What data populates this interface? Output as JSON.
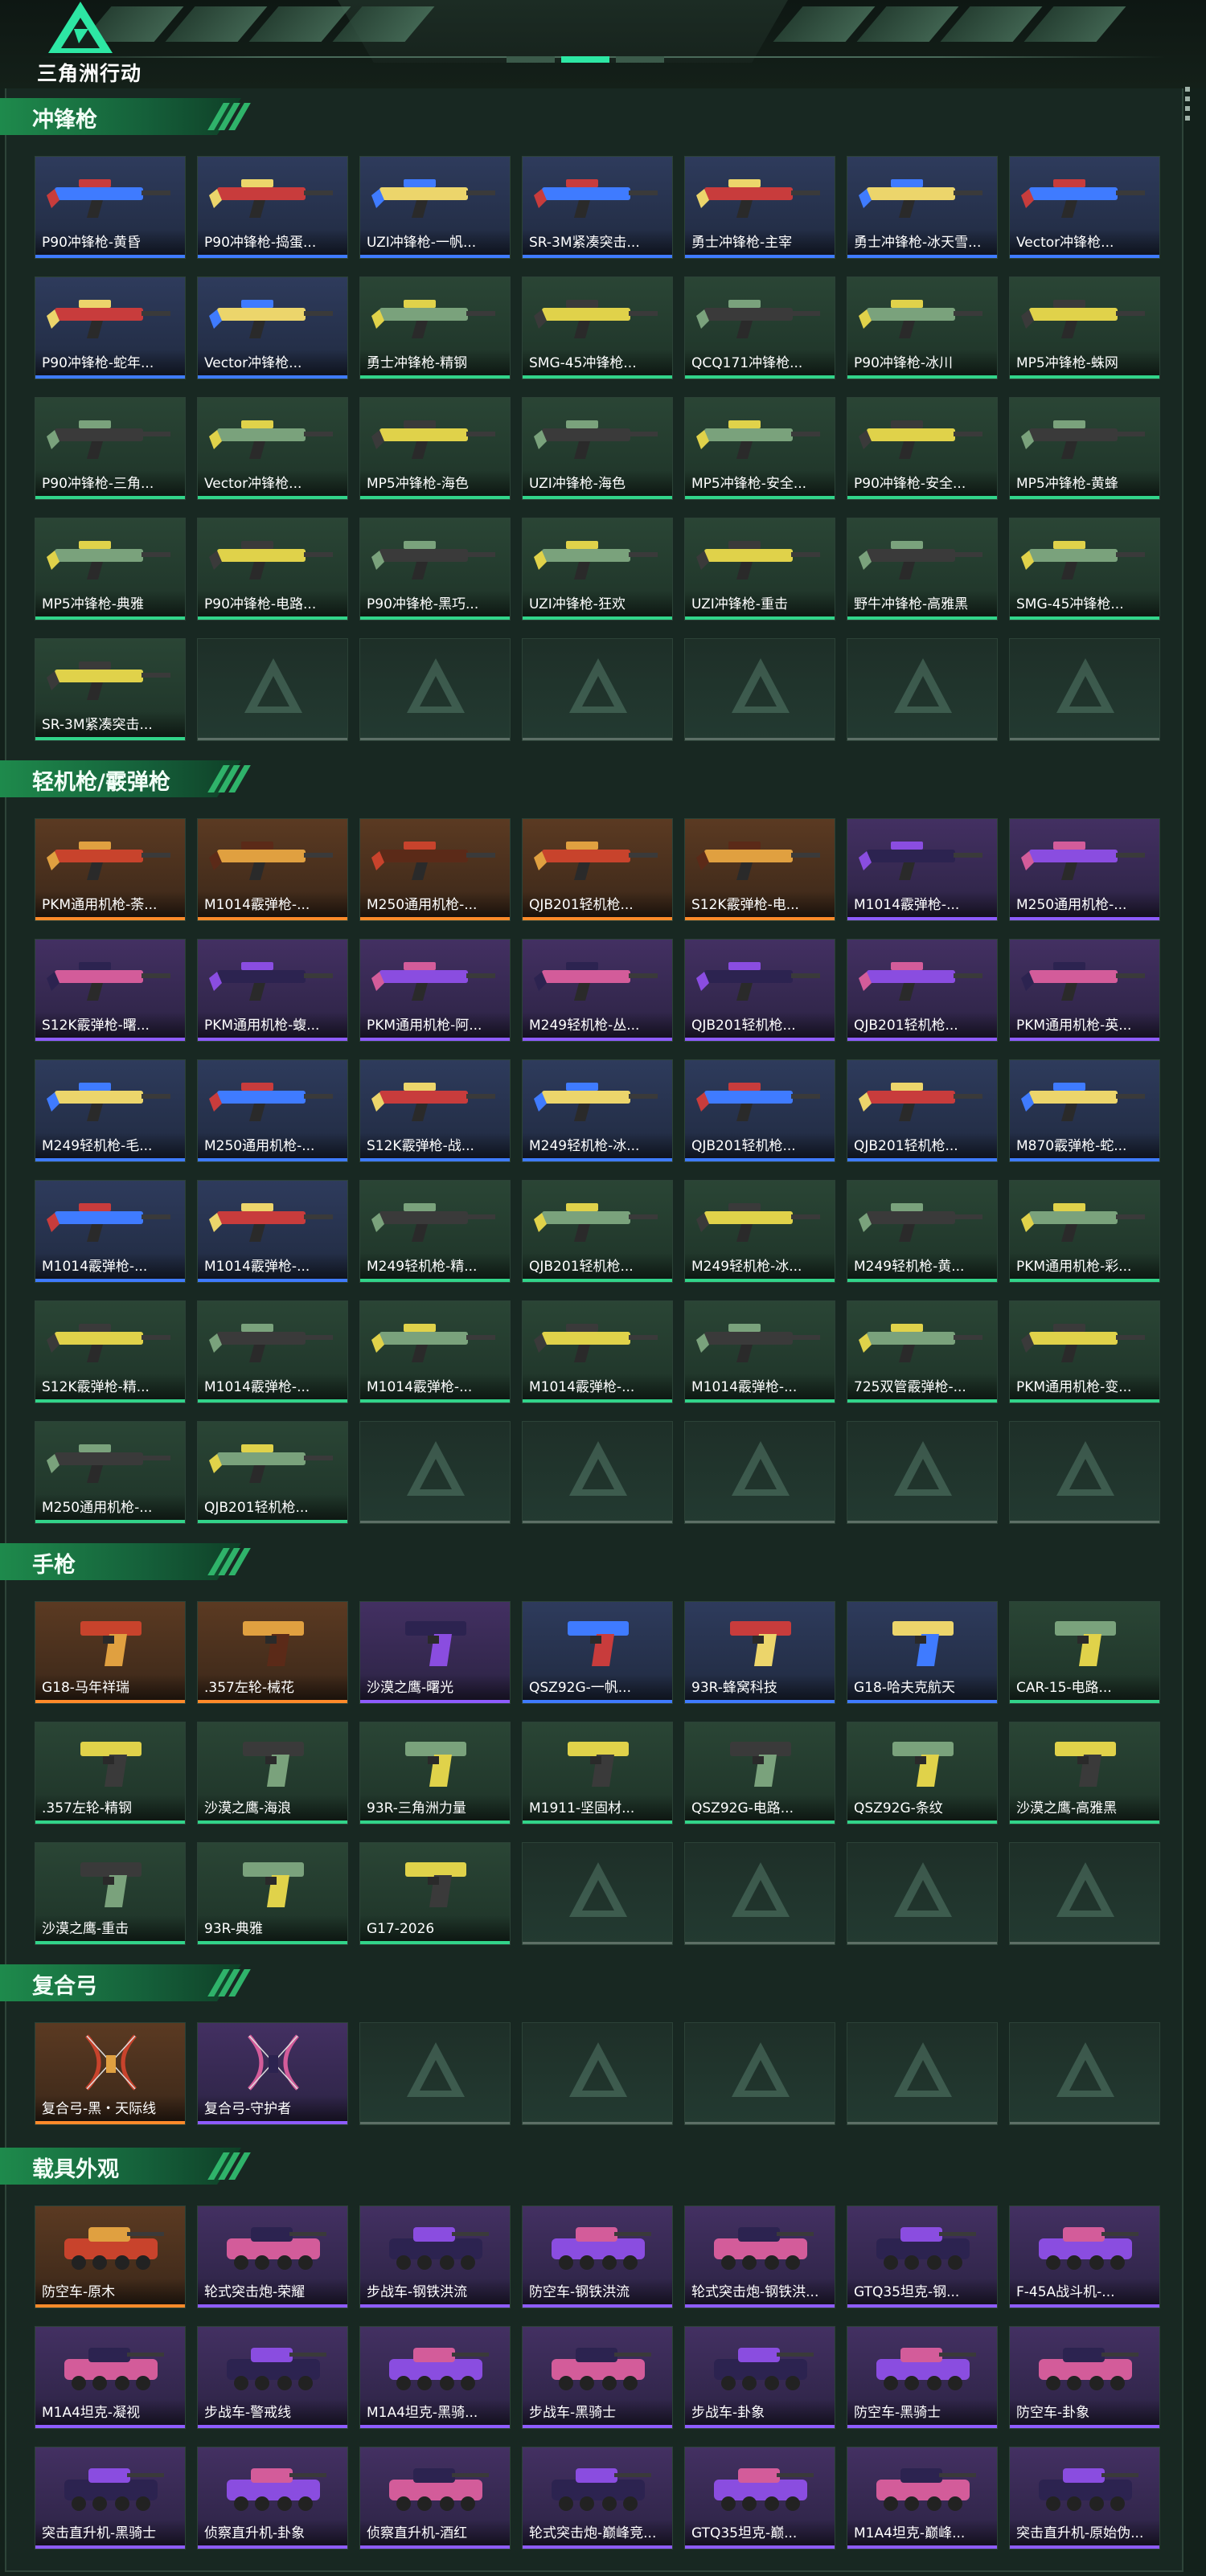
{
  "brand": {
    "logo_text": "三角洲行动"
  },
  "colors": {
    "accent": "#2de7a4",
    "section": "#1e8a4c",
    "quality_purple": "#8e5cff",
    "quality_orange": "#ff8a2a",
    "quality_blue": "#3f7bff",
    "quality_green": "#32d48a"
  },
  "sections": [
    {
      "title": "冲锋枪",
      "icon": "smg",
      "items": [
        {
          "label": "P90冲锋枪-黄昏",
          "quality": "blue"
        },
        {
          "label": "P90冲锋枪-捣蛋...",
          "quality": "blue"
        },
        {
          "label": "UZI冲锋枪-一帆...",
          "quality": "blue"
        },
        {
          "label": "SR-3M紧凑突击...",
          "quality": "blue"
        },
        {
          "label": "勇士冲锋枪-主宰",
          "quality": "blue"
        },
        {
          "label": "勇士冲锋枪-冰天雪...",
          "quality": "blue"
        },
        {
          "label": "Vector冲锋枪...",
          "quality": "blue"
        },
        {
          "label": "P90冲锋枪-蛇年...",
          "quality": "blue"
        },
        {
          "label": "Vector冲锋枪...",
          "quality": "blue"
        },
        {
          "label": "勇士冲锋枪-精钢",
          "quality": "green"
        },
        {
          "label": "SMG-45冲锋枪...",
          "quality": "green"
        },
        {
          "label": "QCQ171冲锋枪...",
          "quality": "green"
        },
        {
          "label": "P90冲锋枪-冰川",
          "quality": "green"
        },
        {
          "label": "MP5冲锋枪-蛛网",
          "quality": "green"
        },
        {
          "label": "P90冲锋枪-三角...",
          "quality": "green"
        },
        {
          "label": "Vector冲锋枪...",
          "quality": "green"
        },
        {
          "label": "MP5冲锋枪-海色",
          "quality": "green"
        },
        {
          "label": "UZI冲锋枪-海色",
          "quality": "green"
        },
        {
          "label": "MP5冲锋枪-安全...",
          "quality": "green"
        },
        {
          "label": "P90冲锋枪-安全...",
          "quality": "green"
        },
        {
          "label": "MP5冲锋枪-黄蜂",
          "quality": "green"
        },
        {
          "label": "MP5冲锋枪-典雅",
          "quality": "green"
        },
        {
          "label": "P90冲锋枪-电路...",
          "quality": "green"
        },
        {
          "label": "P90冲锋枪-黑巧...",
          "quality": "green"
        },
        {
          "label": "UZI冲锋枪-狂欢",
          "quality": "green"
        },
        {
          "label": "UZI冲锋枪-重击",
          "quality": "green"
        },
        {
          "label": "野牛冲锋枪-高雅黑",
          "quality": "green"
        },
        {
          "label": "SMG-45冲锋枪...",
          "quality": "green"
        },
        {
          "label": "SR-3M紧凑突击...",
          "quality": "green"
        }
      ],
      "empty_slots": 6
    },
    {
      "title": "轻机枪/霰弹枪",
      "icon": "lmg",
      "items": [
        {
          "label": "PKM通用机枪-荼...",
          "quality": "orange"
        },
        {
          "label": "M1014霰弹枪-...",
          "quality": "orange"
        },
        {
          "label": "M250通用机枪-...",
          "quality": "orange"
        },
        {
          "label": "QJB201轻机枪...",
          "quality": "orange"
        },
        {
          "label": "S12K霰弹枪-电...",
          "quality": "orange"
        },
        {
          "label": "M1014霰弹枪-...",
          "quality": "purple"
        },
        {
          "label": "M250通用机枪-...",
          "quality": "purple"
        },
        {
          "label": "S12K霰弹枪-曙...",
          "quality": "purple"
        },
        {
          "label": "PKM通用机枪-蝮...",
          "quality": "purple"
        },
        {
          "label": "PKM通用机枪-阿...",
          "quality": "purple"
        },
        {
          "label": "M249轻机枪-丛...",
          "quality": "purple"
        },
        {
          "label": "QJB201轻机枪...",
          "quality": "purple"
        },
        {
          "label": "QJB201轻机枪...",
          "quality": "purple"
        },
        {
          "label": "PKM通用机枪-英...",
          "quality": "purple"
        },
        {
          "label": "M249轻机枪-毛...",
          "quality": "blue"
        },
        {
          "label": "M250通用机枪-...",
          "quality": "blue"
        },
        {
          "label": "S12K霰弹枪-战...",
          "quality": "blue"
        },
        {
          "label": "M249轻机枪-冰...",
          "quality": "blue"
        },
        {
          "label": "QJB201轻机枪...",
          "quality": "blue"
        },
        {
          "label": "QJB201轻机枪...",
          "quality": "blue"
        },
        {
          "label": "M870霰弹枪-蛇...",
          "quality": "blue"
        },
        {
          "label": "M1014霰弹枪-...",
          "quality": "blue"
        },
        {
          "label": "M1014霰弹枪-...",
          "quality": "blue"
        },
        {
          "label": "M249轻机枪-精...",
          "quality": "green"
        },
        {
          "label": "QJB201轻机枪...",
          "quality": "green"
        },
        {
          "label": "M249轻机枪-冰...",
          "quality": "green"
        },
        {
          "label": "M249轻机枪-黄...",
          "quality": "green"
        },
        {
          "label": "PKM通用机枪-彩...",
          "quality": "green"
        },
        {
          "label": "S12K霰弹枪-精...",
          "quality": "green"
        },
        {
          "label": "M1014霰弹枪-...",
          "quality": "green"
        },
        {
          "label": "M1014霰弹枪-...",
          "quality": "green"
        },
        {
          "label": "M1014霰弹枪-...",
          "quality": "green"
        },
        {
          "label": "M1014霰弹枪-...",
          "quality": "green"
        },
        {
          "label": "725双管霰弹枪-...",
          "quality": "green"
        },
        {
          "label": "PKM通用机枪-变...",
          "quality": "green"
        },
        {
          "label": "M250通用机枪-...",
          "quality": "green"
        },
        {
          "label": "QJB201轻机枪...",
          "quality": "green"
        }
      ],
      "empty_slots": 5
    },
    {
      "title": "手枪",
      "icon": "pistol",
      "items": [
        {
          "label": "G18-马年祥瑞",
          "quality": "orange"
        },
        {
          "label": ".357左轮-械花",
          "quality": "orange"
        },
        {
          "label": "沙漠之鹰-曙光",
          "quality": "purple"
        },
        {
          "label": "QSZ92G-一帆...",
          "quality": "blue"
        },
        {
          "label": "93R-蜂窝科技",
          "quality": "blue"
        },
        {
          "label": "G18-哈夫克航天",
          "quality": "blue"
        },
        {
          "label": "CAR-15-电路...",
          "quality": "green"
        },
        {
          "label": ".357左轮-精钢",
          "quality": "green"
        },
        {
          "label": "沙漠之鹰-海浪",
          "quality": "green"
        },
        {
          "label": "93R-三角洲力量",
          "quality": "green"
        },
        {
          "label": "M1911-坚固材...",
          "quality": "green"
        },
        {
          "label": "QSZ92G-电路...",
          "quality": "green"
        },
        {
          "label": "QSZ92G-条纹",
          "quality": "green"
        },
        {
          "label": "沙漠之鹰-高雅黑",
          "quality": "green"
        },
        {
          "label": "沙漠之鹰-重击",
          "quality": "green"
        },
        {
          "label": "93R-典雅",
          "quality": "green"
        },
        {
          "label": "G17-2026",
          "quality": "green"
        }
      ],
      "empty_slots": 4
    },
    {
      "title": "复合弓",
      "icon": "bow",
      "items": [
        {
          "label": "复合弓-黑・天际线",
          "quality": "orange"
        },
        {
          "label": "复合弓-守护者",
          "quality": "purple"
        }
      ],
      "empty_slots": 5
    },
    {
      "title": "载具外观",
      "icon": "vehicle",
      "items": [
        {
          "label": "防空车-原木",
          "quality": "orange"
        },
        {
          "label": "轮式突击炮-荣耀",
          "quality": "purple"
        },
        {
          "label": "步战车-钢铁洪流",
          "quality": "purple"
        },
        {
          "label": "防空车-钢铁洪流",
          "quality": "purple"
        },
        {
          "label": "轮式突击炮-钢铁洪...",
          "quality": "purple"
        },
        {
          "label": "GTQ35坦克-钢...",
          "quality": "purple"
        },
        {
          "label": "F-45A战斗机-...",
          "quality": "purple"
        },
        {
          "label": "M1A4坦克-凝视",
          "quality": "purple"
        },
        {
          "label": "步战车-警戒线",
          "quality": "purple"
        },
        {
          "label": "M1A4坦克-黑骑...",
          "quality": "purple"
        },
        {
          "label": "步战车-黑骑士",
          "quality": "purple"
        },
        {
          "label": "步战车-卦象",
          "quality": "purple"
        },
        {
          "label": "防空车-黑骑士",
          "quality": "purple"
        },
        {
          "label": "防空车-卦象",
          "quality": "purple"
        },
        {
          "label": "突击直升机-黑骑士",
          "quality": "purple"
        },
        {
          "label": "侦察直升机-卦象",
          "quality": "purple"
        },
        {
          "label": "侦察直升机-酒红",
          "quality": "purple"
        },
        {
          "label": "轮式突击炮-巅峰竞...",
          "quality": "purple"
        },
        {
          "label": "GTQ35坦克-巅...",
          "quality": "purple"
        },
        {
          "label": "M1A4坦克-巅峰...",
          "quality": "purple"
        },
        {
          "label": "突击直升机-原始伪...",
          "quality": "purple"
        }
      ],
      "empty_slots": 0
    }
  ]
}
